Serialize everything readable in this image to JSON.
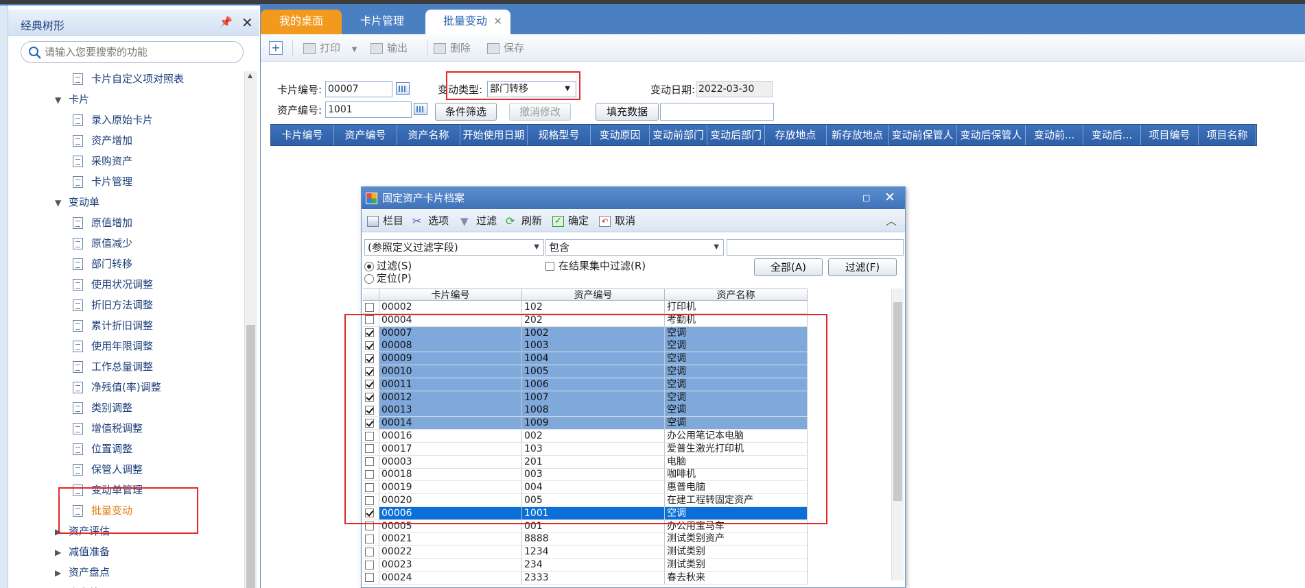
{
  "sidebar": {
    "title": "经典树形",
    "search_placeholder": "请输入您要搜索的功能",
    "tree": [
      {
        "label": "卡片自定义项对照表",
        "level": 2,
        "type": "leaf"
      },
      {
        "label": "卡片",
        "level": 1,
        "type": "folder",
        "expanded": true
      },
      {
        "label": "录入原始卡片",
        "level": 2,
        "type": "leaf"
      },
      {
        "label": "资产增加",
        "level": 2,
        "type": "leaf"
      },
      {
        "label": "采购资产",
        "level": 2,
        "type": "leaf"
      },
      {
        "label": "卡片管理",
        "level": 2,
        "type": "leaf"
      },
      {
        "label": "变动单",
        "level": 1,
        "type": "folder",
        "expanded": true
      },
      {
        "label": "原值增加",
        "level": 2,
        "type": "leaf"
      },
      {
        "label": "原值减少",
        "level": 2,
        "type": "leaf"
      },
      {
        "label": "部门转移",
        "level": 2,
        "type": "leaf"
      },
      {
        "label": "使用状况调整",
        "level": 2,
        "type": "leaf"
      },
      {
        "label": "折旧方法调整",
        "level": 2,
        "type": "leaf"
      },
      {
        "label": "累计折旧调整",
        "level": 2,
        "type": "leaf"
      },
      {
        "label": "使用年限调整",
        "level": 2,
        "type": "leaf"
      },
      {
        "label": "工作总量调整",
        "level": 2,
        "type": "leaf"
      },
      {
        "label": "净残值(率)调整",
        "level": 2,
        "type": "leaf"
      },
      {
        "label": "类别调整",
        "level": 2,
        "type": "leaf"
      },
      {
        "label": "增值税调整",
        "level": 2,
        "type": "leaf"
      },
      {
        "label": "位置调整",
        "level": 2,
        "type": "leaf"
      },
      {
        "label": "保管人调整",
        "level": 2,
        "type": "leaf"
      },
      {
        "label": "变动单管理",
        "level": 2,
        "type": "leaf"
      },
      {
        "label": "批量变动",
        "level": 2,
        "type": "leaf",
        "active": true
      },
      {
        "label": "资产评估",
        "level": 1,
        "type": "folder",
        "expanded": false
      },
      {
        "label": "减值准备",
        "level": 1,
        "type": "folder",
        "expanded": false
      },
      {
        "label": "资产盘点",
        "level": 1,
        "type": "folder",
        "expanded": false
      },
      {
        "label": "资产处置",
        "level": 1,
        "type": "folder",
        "expanded": false
      }
    ]
  },
  "tabs": [
    {
      "label": "我的桌面"
    },
    {
      "label": "卡片管理"
    },
    {
      "label": "批量变动",
      "active": true
    }
  ],
  "toolbar": {
    "print": "打印",
    "export": "输出",
    "delete": "删除",
    "save": "保存"
  },
  "form": {
    "card_no_label": "卡片编号:",
    "card_no_value": "00007",
    "asset_no_label": "资产编号:",
    "asset_no_value": "1001",
    "change_type_label": "变动类型:",
    "change_type_value": "部门转移",
    "change_date_label": "变动日期:",
    "change_date_value": "2022-03-30",
    "filter_button": "条件筛选",
    "cancel_edit_button": "撤消修改",
    "fill_button": "填充数据"
  },
  "grid_columns": [
    "卡片编号",
    "资产编号",
    "资产名称",
    "开始使用日期",
    "规格型号",
    "变动原因",
    "变动前部门",
    "变动后部门",
    "存放地点",
    "新存放地点",
    "变动前保管人",
    "变动后保管人",
    "变动前...",
    "变动后...",
    "项目编号",
    "项目名称"
  ],
  "dialog": {
    "title": "固定资产卡片档案",
    "toolbar": {
      "columns": "栏目",
      "options": "选项",
      "filter": "过滤",
      "refresh": "刷新",
      "ok": "确定",
      "cancel": "取消"
    },
    "field_select": "(参照定义过滤字段)",
    "op_select": "包含",
    "filter_value": "",
    "radio_filter": "过滤(S)",
    "radio_locate": "定位(P)",
    "in_result_filter": "在结果集中过滤(R)",
    "all_button": "全部(A)",
    "filter_button": "过滤(F)",
    "columns": [
      "卡片编号",
      "资产编号",
      "资产名称"
    ],
    "rows": [
      {
        "checked": false,
        "state": "",
        "card": "00002",
        "asset": "102",
        "name": "打印机"
      },
      {
        "checked": false,
        "state": "",
        "card": "00004",
        "asset": "202",
        "name": "考勤机"
      },
      {
        "checked": true,
        "state": "sel",
        "card": "00007",
        "asset": "1002",
        "name": "空调"
      },
      {
        "checked": true,
        "state": "sel",
        "card": "00008",
        "asset": "1003",
        "name": "空调"
      },
      {
        "checked": true,
        "state": "sel",
        "card": "00009",
        "asset": "1004",
        "name": "空调"
      },
      {
        "checked": true,
        "state": "sel",
        "card": "00010",
        "asset": "1005",
        "name": "空调"
      },
      {
        "checked": true,
        "state": "sel",
        "card": "00011",
        "asset": "1006",
        "name": "空调"
      },
      {
        "checked": true,
        "state": "sel",
        "card": "00012",
        "asset": "1007",
        "name": "空调"
      },
      {
        "checked": true,
        "state": "sel",
        "card": "00013",
        "asset": "1008",
        "name": "空调"
      },
      {
        "checked": true,
        "state": "sel",
        "card": "00014",
        "asset": "1009",
        "name": "空调"
      },
      {
        "checked": false,
        "state": "",
        "card": "00016",
        "asset": "002",
        "name": "办公用笔记本电脑"
      },
      {
        "checked": false,
        "state": "",
        "card": "00017",
        "asset": "103",
        "name": "爱普生激光打印机"
      },
      {
        "checked": false,
        "state": "",
        "card": "00003",
        "asset": "201",
        "name": "电脑"
      },
      {
        "checked": false,
        "state": "",
        "card": "00018",
        "asset": "003",
        "name": "咖啡机"
      },
      {
        "checked": false,
        "state": "",
        "card": "00019",
        "asset": "004",
        "name": "惠普电脑"
      },
      {
        "checked": false,
        "state": "",
        "card": "00020",
        "asset": "005",
        "name": "在建工程转固定资产"
      },
      {
        "checked": true,
        "state": "cur",
        "card": "00006",
        "asset": "1001",
        "name": "空调"
      },
      {
        "checked": false,
        "state": "",
        "card": "00005",
        "asset": "001",
        "name": "办公用宝马车"
      },
      {
        "checked": false,
        "state": "",
        "card": "00021",
        "asset": "8888",
        "name": "测试类别资产"
      },
      {
        "checked": false,
        "state": "",
        "card": "00022",
        "asset": "1234",
        "name": "测试类别"
      },
      {
        "checked": false,
        "state": "",
        "card": "00023",
        "asset": "234",
        "name": "测试类别"
      },
      {
        "checked": false,
        "state": "",
        "card": "00024",
        "asset": "2333",
        "name": "春去秋来"
      }
    ]
  },
  "colors": {
    "accent_blue": "#4a7fc1",
    "tab_orange": "#f29a1e",
    "highlight_red": "#e32626",
    "selected_row": "#7fa8db",
    "current_row": "#0a6fd8"
  }
}
